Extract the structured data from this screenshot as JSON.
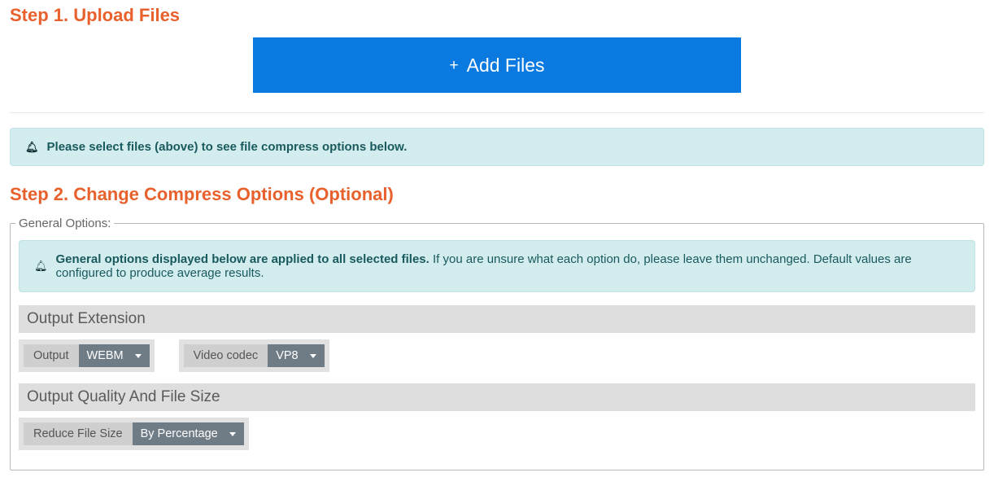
{
  "step1": {
    "title": "Step 1. Upload Files",
    "add_files_label": "Add Files"
  },
  "notice_select_files": "Please select files (above) to see file compress options below.",
  "step2": {
    "title": "Step 2. Change Compress Options (Optional)",
    "legend": "General Options:",
    "info_strong": "General options displayed below are applied to all selected files.",
    "info_rest": " If you are unsure what each option do, please leave them unchanged. Default values are configured to produce average results.",
    "section_output_ext": "Output Extension",
    "output_label": "Output",
    "output_value": "WEBM",
    "codec_label": "Video codec",
    "codec_value": "VP8",
    "section_quality": "Output Quality And File Size",
    "reduce_label": "Reduce File Size",
    "reduce_value": "By Percentage"
  }
}
